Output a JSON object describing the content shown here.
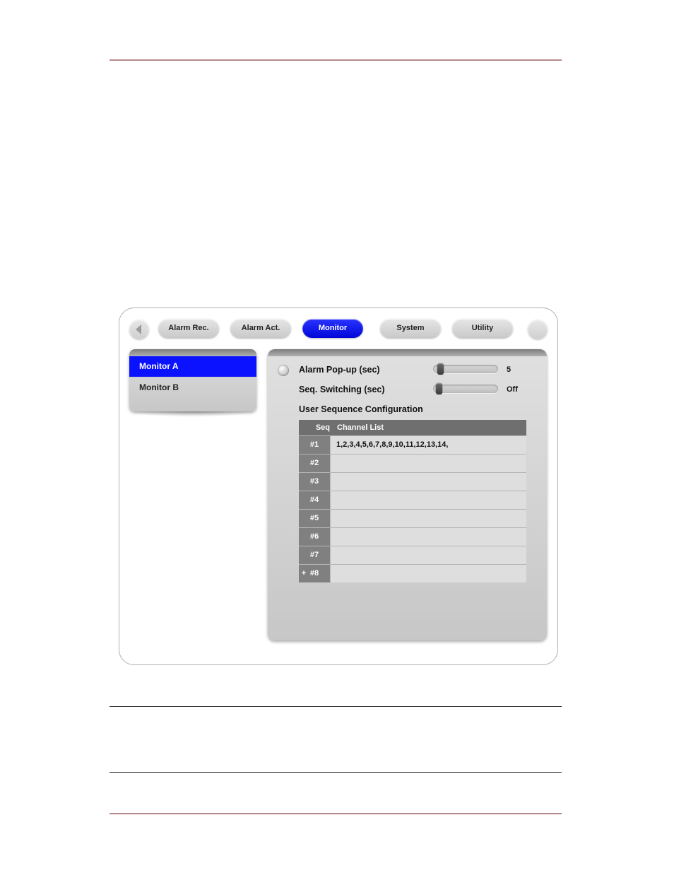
{
  "tabs": {
    "alarm_rec": "Alarm Rec.",
    "alarm_act": "Alarm Act.",
    "monitor": "Monitor",
    "system": "System",
    "utility": "Utility"
  },
  "sidebar": {
    "monitor_a": "Monitor A",
    "monitor_b": "Monitor B"
  },
  "settings": {
    "alarm_popup_label": "Alarm Pop-up (sec)",
    "alarm_popup_value": "5",
    "seq_switching_label": "Seq. Switching (sec)",
    "seq_switching_value": "Off",
    "user_seq_title": "User Sequence Configuration"
  },
  "seq_table": {
    "header_seq": "Seq",
    "header_list": "Channel List",
    "rows": [
      {
        "id": "#1",
        "list": "1,2,3,4,5,6,7,8,9,10,11,12,13,14,"
      },
      {
        "id": "#2",
        "list": ""
      },
      {
        "id": "#3",
        "list": ""
      },
      {
        "id": "#4",
        "list": ""
      },
      {
        "id": "#5",
        "list": ""
      },
      {
        "id": "#6",
        "list": ""
      },
      {
        "id": "#7",
        "list": ""
      },
      {
        "id": "#8",
        "list": ""
      }
    ],
    "plus_on_last": "+"
  }
}
